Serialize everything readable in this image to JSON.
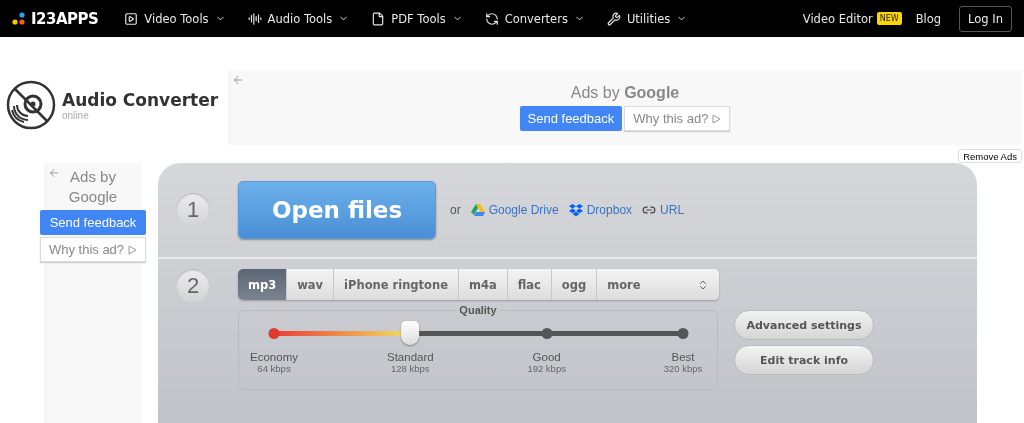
{
  "nav": {
    "logo": "I23APPS",
    "items": [
      {
        "label": "Video Tools"
      },
      {
        "label": "Audio Tools"
      },
      {
        "label": "PDF Tools"
      },
      {
        "label": "Converters"
      },
      {
        "label": "Utilities"
      }
    ],
    "video_editor": "Video Editor",
    "new_badge": "NEW",
    "blog": "Blog",
    "login": "Log In"
  },
  "app": {
    "title": "Audio Converter",
    "subtitle": "online"
  },
  "top_ad": {
    "ads_by": "Ads by",
    "google": "Google",
    "feedback": "Send feedback",
    "why": "Why this ad?"
  },
  "remove_ads": "Remove Ads",
  "side_ad": {
    "ads_by": "Ads by",
    "google": "Google",
    "feedback": "Send feedback",
    "why": "Why this ad?"
  },
  "step1": {
    "number": "1",
    "open": "Open files",
    "or": "or",
    "sources": [
      {
        "label": "Google Drive"
      },
      {
        "label": "Dropbox"
      },
      {
        "label": "URL"
      }
    ]
  },
  "step2": {
    "number": "2",
    "formats": [
      {
        "label": "mp3",
        "selected": true
      },
      {
        "label": "wav",
        "selected": false
      },
      {
        "label": "iPhone ringtone",
        "selected": false
      },
      {
        "label": "m4a",
        "selected": false
      },
      {
        "label": "flac",
        "selected": false
      },
      {
        "label": "ogg",
        "selected": false
      }
    ],
    "more": "more",
    "quality": {
      "title": "Quality",
      "level": 0.3333,
      "stops": [
        {
          "name": "Economy",
          "rate": "64 kbps"
        },
        {
          "name": "Standard",
          "rate": "128 kbps"
        },
        {
          "name": "Good",
          "rate": "192 kbps"
        },
        {
          "name": "Best",
          "rate": "320 kbps"
        }
      ]
    },
    "buttons": [
      "Advanced settings",
      "Edit track info"
    ]
  }
}
